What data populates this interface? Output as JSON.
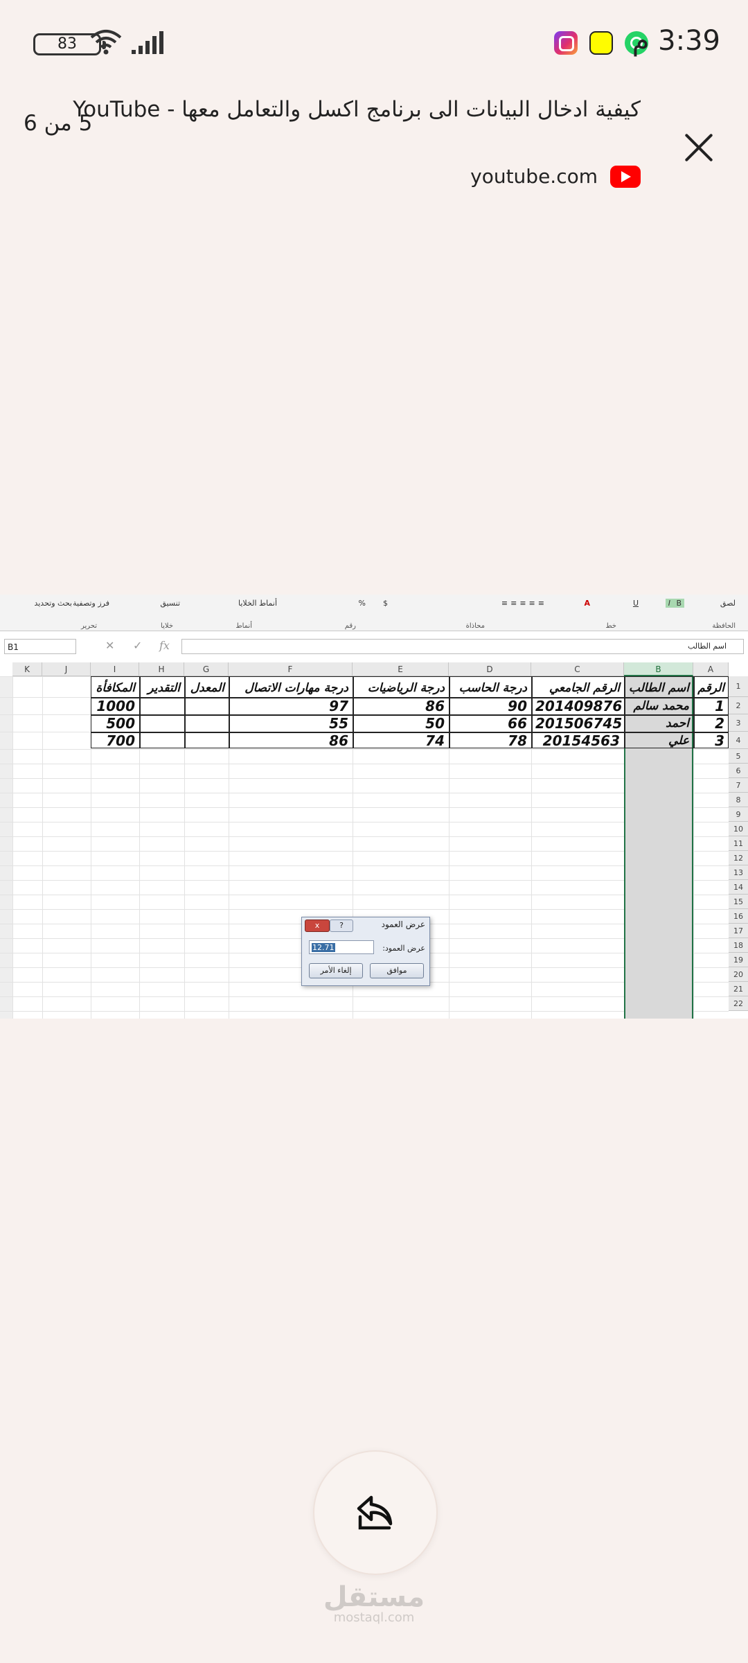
{
  "status_bar": {
    "time": "3:39 م",
    "battery": "83",
    "apps": [
      "instagram-icon",
      "snapchat-icon",
      "whatsapp-icon"
    ]
  },
  "header": {
    "page_count": "5 من 6",
    "title": "كيفية ادخال البيانات الى برنامج اكسل والتعامل معها - YouTube",
    "source": "youtube.com"
  },
  "excel": {
    "ribbon": {
      "groups": [
        "الحافظة",
        "خط",
        "محاذاة",
        "رقم",
        "أنماط",
        "خلايا",
        "تحرير"
      ],
      "controls": [
        "لصق",
        "B",
        "I",
        "U",
        "$",
        "%",
        "أنماط الخلايا",
        "تنسيق",
        "فرز وتصفية",
        "بحث وتحديد"
      ]
    },
    "name_box": "B1",
    "formula_value": "اسم الطالب",
    "column_letters": [
      "A",
      "B",
      "C",
      "D",
      "E",
      "F",
      "G",
      "H",
      "I",
      "J",
      "K"
    ],
    "row_numbers": [
      "1",
      "2",
      "3",
      "4",
      "5",
      "6",
      "7",
      "8",
      "9",
      "10",
      "11",
      "12",
      "13",
      "14",
      "15",
      "16",
      "17",
      "18",
      "19",
      "20",
      "21",
      "22"
    ],
    "table_headers": [
      "الرقم",
      "اسم الطالب",
      "الرقم الجامعي",
      "درجة الحاسب",
      "درجة الرياضيات",
      "درجة مهارات الاتصال",
      "المعدل",
      "التقدير",
      "المكافأة"
    ],
    "rows": [
      [
        "1",
        "محمد سالم",
        "201409876",
        "90",
        "86",
        "97",
        "",
        "",
        "1000"
      ],
      [
        "2",
        "احمد",
        "201506745",
        "66",
        "50",
        "55",
        "",
        "",
        "500"
      ],
      [
        "3",
        "علي",
        "20154563",
        "78",
        "74",
        "86",
        "",
        "",
        "700"
      ]
    ],
    "dialog": {
      "title": "عرض العمود",
      "label": "عرض العمود:",
      "value": "12.71",
      "ok": "موافق",
      "cancel": "إلغاء الأمر",
      "close": "x",
      "help": "?"
    }
  },
  "watermark": {
    "arabic": "مستقل",
    "latin": "mostaql.com"
  },
  "colors": {
    "background": "#f8f1ee",
    "excel_green": "#217346",
    "youtube_red": "#ff0000"
  }
}
